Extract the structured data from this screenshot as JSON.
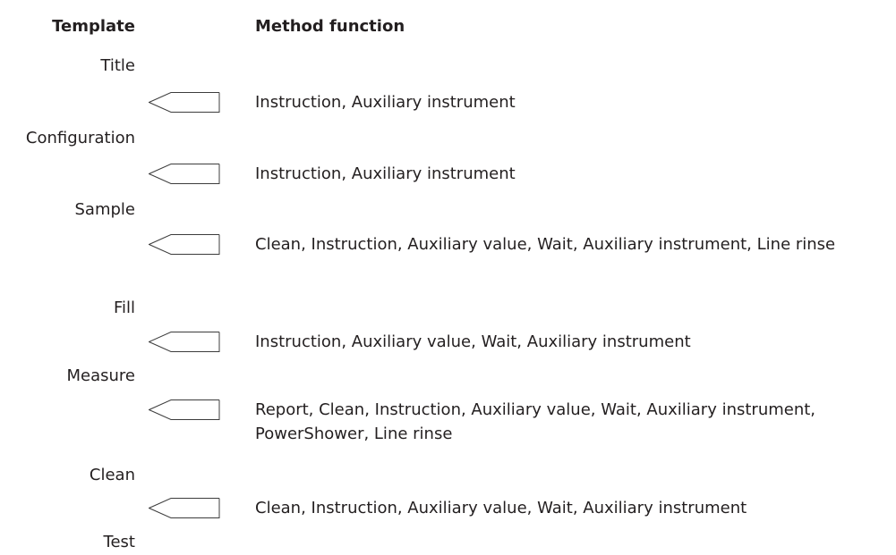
{
  "header": {
    "template_label": "Template",
    "method_function_label": "Method function"
  },
  "sections": [
    {
      "label": "Title",
      "functions": "Instruction, Auxiliary instrument"
    },
    {
      "label": "Configuration",
      "functions": "Instruction, Auxiliary instrument"
    },
    {
      "label": "Sample",
      "functions": "Clean, Instruction, Auxiliary value, Wait, Auxiliary instrument, Line rinse"
    },
    {
      "label": "Fill",
      "functions": "Instruction, Auxiliary value, Wait, Auxiliary instrument"
    },
    {
      "label": "Measure",
      "functions": "Report, Clean, Instruction, Auxiliary value, Wait, Auxiliary instrument, PowerShower, Line rinse"
    },
    {
      "label": "Clean",
      "functions": "Clean, Instruction, Auxiliary value, Wait, Auxiliary instrument"
    },
    {
      "label": "Test",
      "functions": ""
    }
  ],
  "icons": {
    "insert_marker": "insert-arrow-icon"
  },
  "colors": {
    "text": "#231f20",
    "line": "#3c3c3c"
  }
}
